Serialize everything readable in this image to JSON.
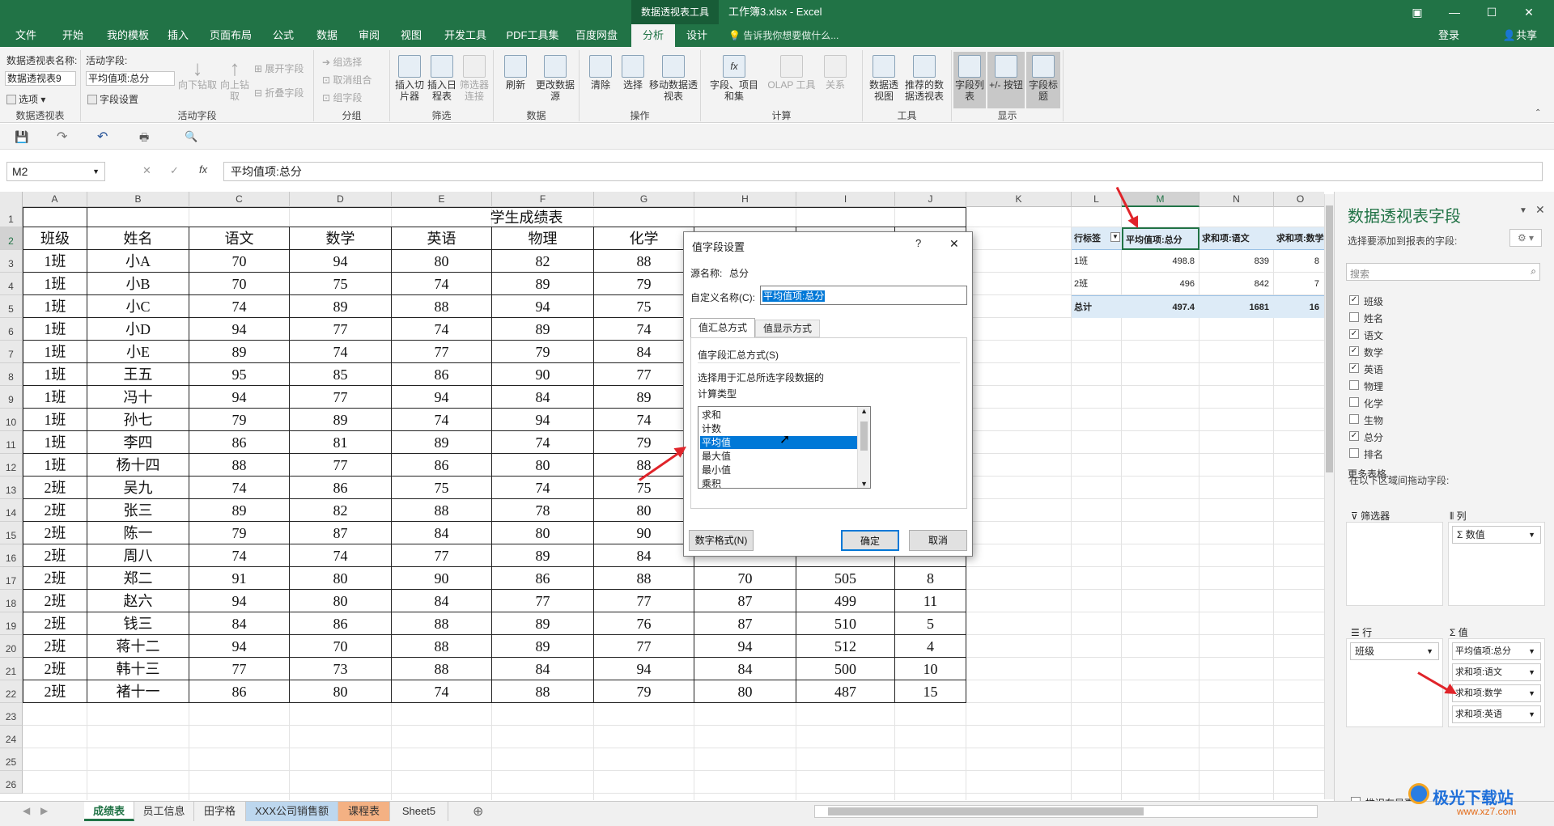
{
  "window": {
    "context_tab": "数据透视表工具",
    "doc_title": "工作簿3.xlsx - Excel"
  },
  "menu": {
    "tabs": [
      "文件",
      "开始",
      "我的模板",
      "插入",
      "页面布局",
      "公式",
      "数据",
      "审阅",
      "视图",
      "开发工具",
      "PDF工具集",
      "百度网盘",
      "分析",
      "设计"
    ],
    "active": "分析",
    "tell_me": "告诉我你想要做什么...",
    "login": "登录",
    "share": "共享"
  },
  "ribbon": {
    "pivot_name_label": "数据透视表名称:",
    "pivot_name_value": "数据透视表9",
    "options": "选项",
    "group_pivot": "数据透视表",
    "active_field_label": "活动字段:",
    "active_field_value": "平均值项:总分",
    "field_settings": "字段设置",
    "drill_down": "向下钻取",
    "drill_up": "向上钻取",
    "expand_field": "展开字段",
    "collapse_field": "折叠字段",
    "group_active": "活动字段",
    "group_selection": "组选择",
    "ungroup": "取消组合",
    "group_field": "组字段",
    "group_group": "分组",
    "insert_slicer": "插入切片器",
    "insert_timeline": "插入日程表",
    "filter_conn": "筛选器连接",
    "group_filter": "筛选",
    "refresh": "刷新",
    "change_source": "更改数据源",
    "group_data": "数据",
    "clear": "清除",
    "select": "选择",
    "move_pivot": "移动数据透视表",
    "group_actions": "操作",
    "fields_items": "字段、项目和集",
    "olap": "OLAP 工具",
    "relations": "关系",
    "group_calc": "计算",
    "pivotchart": "数据透视图",
    "recommended": "推荐的数据透视表",
    "group_tools": "工具",
    "field_list": "字段列表",
    "plus_minus": "+/- 按钮",
    "field_headers": "字段标题",
    "group_show": "显示"
  },
  "formula": {
    "name_box": "M2",
    "value": "平均值项:总分"
  },
  "columns": [
    "A",
    "B",
    "C",
    "D",
    "E",
    "F",
    "G",
    "H",
    "I",
    "J",
    "K",
    "L",
    "M",
    "N",
    "O"
  ],
  "rows": [
    "1",
    "2",
    "3",
    "4",
    "5",
    "6",
    "7",
    "8",
    "9",
    "10",
    "11",
    "12",
    "13",
    "14",
    "15",
    "16",
    "17",
    "18",
    "19",
    "20",
    "21",
    "22",
    "23",
    "24",
    "25",
    "26"
  ],
  "table": {
    "title": "学生成绩表",
    "headers": [
      "班级",
      "姓名",
      "语文",
      "数学",
      "英语",
      "物理",
      "化学"
    ],
    "data": [
      [
        "1班",
        "小A",
        "70",
        "94",
        "80",
        "82",
        "88",
        "",
        "",
        ""
      ],
      [
        "1班",
        "小B",
        "70",
        "75",
        "74",
        "89",
        "79",
        "",
        "",
        ""
      ],
      [
        "1班",
        "小C",
        "74",
        "89",
        "88",
        "94",
        "75",
        "",
        "",
        ""
      ],
      [
        "1班",
        "小D",
        "94",
        "77",
        "74",
        "89",
        "74",
        "",
        "",
        ""
      ],
      [
        "1班",
        "小E",
        "89",
        "74",
        "77",
        "79",
        "84",
        "",
        "",
        ""
      ],
      [
        "1班",
        "王五",
        "95",
        "85",
        "86",
        "90",
        "77",
        "",
        "",
        ""
      ],
      [
        "1班",
        "冯十",
        "94",
        "77",
        "94",
        "84",
        "89",
        "",
        "",
        ""
      ],
      [
        "1班",
        "孙七",
        "79",
        "89",
        "74",
        "94",
        "74",
        "",
        "",
        ""
      ],
      [
        "1班",
        "李四",
        "86",
        "81",
        "89",
        "74",
        "79",
        "",
        "",
        ""
      ],
      [
        "1班",
        "杨十四",
        "88",
        "77",
        "86",
        "80",
        "88",
        "",
        "",
        ""
      ],
      [
        "2班",
        "吴九",
        "74",
        "86",
        "75",
        "74",
        "75",
        "",
        "",
        ""
      ],
      [
        "2班",
        "张三",
        "89",
        "82",
        "88",
        "78",
        "80",
        "",
        "",
        ""
      ],
      [
        "2班",
        "陈一",
        "79",
        "87",
        "84",
        "80",
        "90",
        "",
        "",
        ""
      ],
      [
        "2班",
        "周八",
        "74",
        "74",
        "77",
        "89",
        "84",
        "",
        "",
        ""
      ],
      [
        "2班",
        "郑二",
        "91",
        "80",
        "90",
        "86",
        "88",
        "70",
        "505",
        "8"
      ],
      [
        "2班",
        "赵六",
        "94",
        "80",
        "84",
        "77",
        "77",
        "87",
        "499",
        "11"
      ],
      [
        "2班",
        "钱三",
        "84",
        "86",
        "88",
        "89",
        "76",
        "87",
        "510",
        "5"
      ],
      [
        "2班",
        "蒋十二",
        "94",
        "70",
        "88",
        "89",
        "77",
        "94",
        "512",
        "4"
      ],
      [
        "2班",
        "韩十三",
        "77",
        "73",
        "88",
        "84",
        "94",
        "84",
        "500",
        "10"
      ],
      [
        "2班",
        "褚十一",
        "86",
        "80",
        "74",
        "88",
        "79",
        "80",
        "487",
        "15"
      ]
    ]
  },
  "pivot": {
    "headers": [
      "行标签",
      "平均值项:总分",
      "求和项:语文",
      "求和项:数学"
    ],
    "rows": [
      [
        "1班",
        "498.8",
        "839",
        "8"
      ],
      [
        "2班",
        "496",
        "842",
        "7"
      ],
      [
        "总计",
        "497.4",
        "1681",
        "16"
      ]
    ]
  },
  "dialog": {
    "title": "值字段设置",
    "help": "?",
    "close": "✕",
    "source_label": "源名称:",
    "source_value": "总分",
    "custom_label": "自定义名称(C):",
    "custom_value": "平均值项:总分",
    "tab1": "值汇总方式",
    "tab2": "值显示方式",
    "section": "值字段汇总方式(S)",
    "desc1": "选择用于汇总所选字段数据的",
    "desc2": "计算类型",
    "list": [
      "求和",
      "计数",
      "平均值",
      "最大值",
      "最小值",
      "乘积"
    ],
    "selected": "平均值",
    "number_format": "数字格式(N)",
    "ok": "确定",
    "cancel": "取消"
  },
  "pane": {
    "title": "数据透视表字段",
    "subtitle": "选择要添加到报表的字段:",
    "search_placeholder": "搜索",
    "fields": [
      {
        "name": "班级",
        "checked": true
      },
      {
        "name": "姓名",
        "checked": false
      },
      {
        "name": "语文",
        "checked": true
      },
      {
        "name": "数学",
        "checked": true
      },
      {
        "name": "英语",
        "checked": true
      },
      {
        "name": "物理",
        "checked": false
      },
      {
        "name": "化学",
        "checked": false
      },
      {
        "name": "生物",
        "checked": false
      },
      {
        "name": "总分",
        "checked": true
      },
      {
        "name": "排名",
        "checked": false
      }
    ],
    "more": "更多表格...",
    "drag_label": "在以下区域间拖动字段:",
    "filters": "筛选器",
    "columns": "列",
    "columns_item": "数值",
    "rows": "行",
    "rows_item": "班级",
    "values": "值",
    "values_items": [
      "平均值项:总分",
      "求和项:语文",
      "求和项:数学",
      "求和项:英语"
    ],
    "defer": "推迟布局更新"
  },
  "sheets": {
    "tabs": [
      "成绩表",
      "员工信息",
      "田字格",
      "XXX公司销售额",
      "课程表",
      "Sheet5"
    ],
    "active": "成绩表"
  },
  "watermark": {
    "brand": "极光下载站",
    "url": "www.xz7.com"
  }
}
